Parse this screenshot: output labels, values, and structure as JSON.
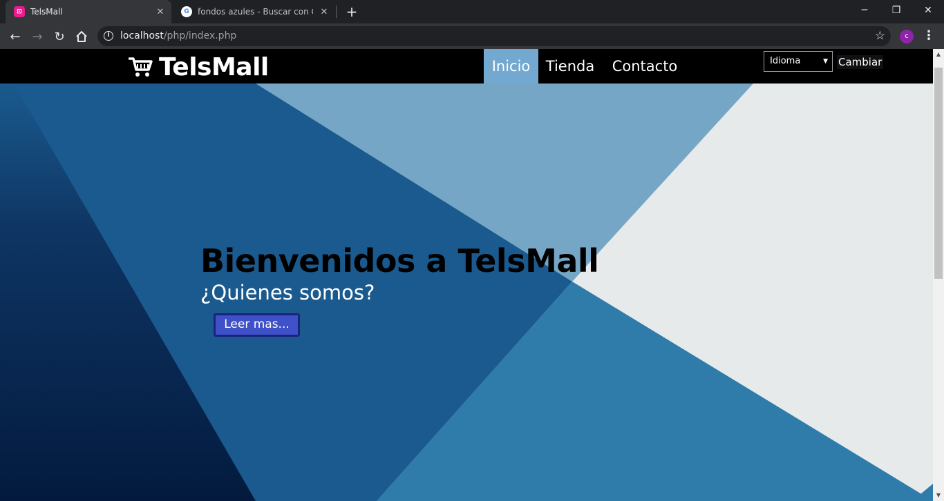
{
  "browser": {
    "tabs": [
      {
        "title": "TelsMall",
        "active": true,
        "favicon": "telsmall-logo-icon"
      },
      {
        "title": "fondos azules - Buscar con Google",
        "active": false,
        "favicon": "google-g-icon"
      }
    ],
    "url_host": "localhost",
    "url_path": "/php/index.php",
    "profile_initial": "c"
  },
  "site": {
    "brand": "TelsMall",
    "nav": {
      "items": [
        {
          "label": "Inicio",
          "active": true
        },
        {
          "label": "Tienda",
          "active": false
        },
        {
          "label": "Contacto",
          "active": false
        }
      ]
    },
    "language_select": {
      "value": "Idioma"
    },
    "change_button": "Cambiar",
    "hero": {
      "title": "Bienvenidos a TelsMall",
      "subtitle": "¿Quienes somos?",
      "button": "Leer mas..."
    }
  },
  "colors": {
    "nav_bg": "#000000",
    "nav_active": "#73a8d1",
    "hero_dark": "#0a2347",
    "hero_mid": "#1a5a8e",
    "hero_light": "#76a6c6",
    "hero_steel": "#2f7cab",
    "hero_pale": "#e6eaeb",
    "button_bg": "#3f51c8"
  }
}
